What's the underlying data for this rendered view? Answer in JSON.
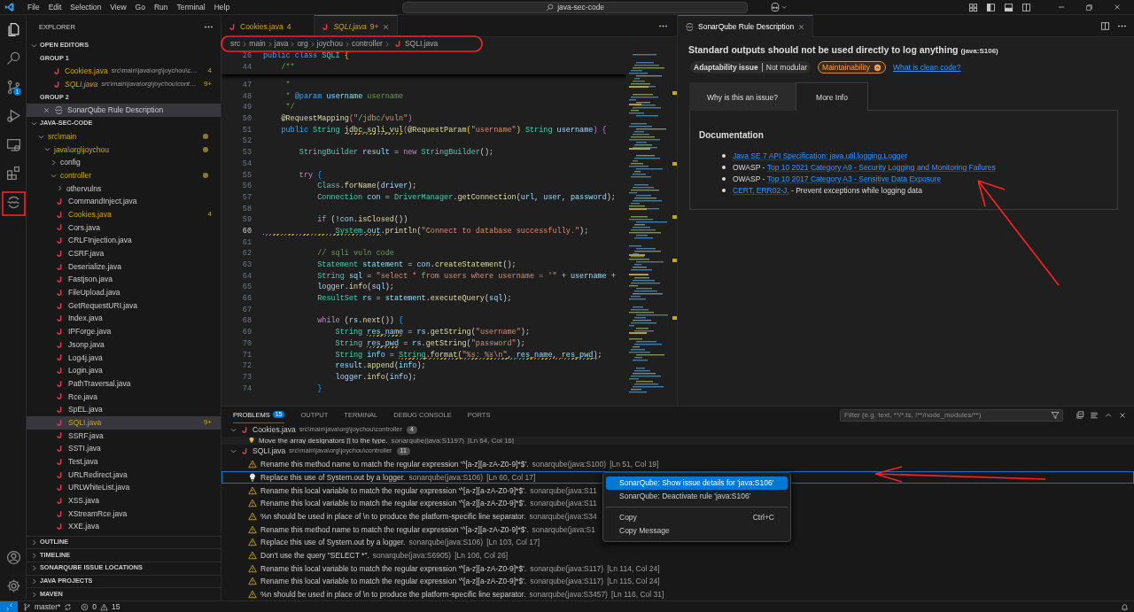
{
  "title_bar": {
    "menu": [
      "File",
      "Edit",
      "Selection",
      "View",
      "Go",
      "Run",
      "Terminal",
      "Help"
    ],
    "command_center": "java-sec-code"
  },
  "activity_bar": {
    "items": [
      {
        "kind": "files"
      },
      {
        "kind": "search"
      },
      {
        "kind": "scm",
        "badge": "1"
      },
      {
        "kind": "debug"
      },
      {
        "kind": "remote"
      },
      {
        "kind": "extensions"
      },
      {
        "kind": "sonar"
      }
    ],
    "bottom": [
      {
        "kind": "account"
      },
      {
        "kind": "gear"
      }
    ]
  },
  "explorer": {
    "title": "EXPLORER",
    "open_editors": {
      "title": "OPEN EDITORS",
      "expanded": true,
      "groups": [
        {
          "title": "GROUP 1",
          "items": [
            {
              "kind": "java",
              "name": "Cookies.java",
              "path": "src\\main\\java\\org\\joychou\\c…",
              "badge": "4",
              "preview": false,
              "selected": false
            },
            {
              "kind": "java",
              "name": "SQLI.java",
              "path": "src\\main\\java\\org\\joychou\\cont…",
              "badge": "9+",
              "preview": true,
              "selected": false
            }
          ]
        },
        {
          "title": "GROUP 2",
          "items": [
            {
              "kind": "sonar",
              "name": "SonarQube Rule Description",
              "preview": false,
              "selected": true
            }
          ]
        }
      ]
    },
    "project": {
      "title": "JAVA-SEC-CODE",
      "expanded": true,
      "tree": [
        {
          "kind": "folder",
          "label": "src\\main",
          "expanded": true,
          "modified": true,
          "children": [
            {
              "kind": "folder",
              "label": "java\\org\\joychou",
              "expanded": true,
              "modified": true,
              "children": [
                {
                  "kind": "folder",
                  "label": "config",
                  "expanded": false,
                  "modified": false
                },
                {
                  "kind": "folder",
                  "label": "controller",
                  "expanded": true,
                  "modified": true,
                  "children": [
                    {
                      "kind": "folder",
                      "label": "othervulns",
                      "expanded": false,
                      "modified": false
                    },
                    {
                      "kind": "file",
                      "label": "CommandInject.java",
                      "warning": false,
                      "selected": false
                    },
                    {
                      "kind": "file",
                      "label": "Cookies.java",
                      "warning": true,
                      "badge": "4",
                      "selected": false
                    },
                    {
                      "kind": "file",
                      "label": "Cors.java",
                      "warning": false,
                      "selected": false
                    },
                    {
                      "kind": "file",
                      "label": "CRLFInjection.java",
                      "warning": false,
                      "selected": false
                    },
                    {
                      "kind": "file",
                      "label": "CSRF.java",
                      "warning": false,
                      "selected": false
                    },
                    {
                      "kind": "file",
                      "label": "Deserialize.java",
                      "warning": false,
                      "selected": false
                    },
                    {
                      "kind": "file",
                      "label": "Fastjson.java",
                      "warning": false,
                      "selected": false
                    },
                    {
                      "kind": "file",
                      "label": "FileUpload.java",
                      "warning": false,
                      "selected": false
                    },
                    {
                      "kind": "file",
                      "label": "GetRequestURI.java",
                      "warning": false,
                      "selected": false
                    },
                    {
                      "kind": "file",
                      "label": "Index.java",
                      "warning": false,
                      "selected": false
                    },
                    {
                      "kind": "file",
                      "label": "IPForge.java",
                      "warning": false,
                      "selected": false
                    },
                    {
                      "kind": "file",
                      "label": "Jsonp.java",
                      "warning": false,
                      "selected": false
                    },
                    {
                      "kind": "file",
                      "label": "Log4j.java",
                      "warning": false,
                      "selected": false
                    },
                    {
                      "kind": "file",
                      "label": "Login.java",
                      "warning": false,
                      "selected": false
                    },
                    {
                      "kind": "file",
                      "label": "PathTraversal.java",
                      "warning": false,
                      "selected": false
                    },
                    {
                      "kind": "file",
                      "label": "Rce.java",
                      "warning": false,
                      "selected": false
                    },
                    {
                      "kind": "file",
                      "label": "SpEL.java",
                      "warning": false,
                      "selected": false
                    },
                    {
                      "kind": "file",
                      "label": "SQLI.java",
                      "warning": true,
                      "badge": "9+",
                      "selected": true
                    },
                    {
                      "kind": "file",
                      "label": "SSRF.java",
                      "warning": false,
                      "selected": false
                    },
                    {
                      "kind": "file",
                      "label": "SSTI.java",
                      "warning": false,
                      "selected": false
                    },
                    {
                      "kind": "file",
                      "label": "Test.java",
                      "warning": false,
                      "selected": false
                    },
                    {
                      "kind": "file",
                      "label": "URLRedirect.java",
                      "warning": false,
                      "selected": false
                    },
                    {
                      "kind": "file",
                      "label": "URLWhiteList.java",
                      "warning": false,
                      "selected": false
                    },
                    {
                      "kind": "file",
                      "label": "XSS.java",
                      "warning": false,
                      "selected": false
                    },
                    {
                      "kind": "file",
                      "label": "XStreamRce.java",
                      "warning": false,
                      "selected": false
                    },
                    {
                      "kind": "file",
                      "label": "XXE.java",
                      "warning": false,
                      "selected": false
                    }
                  ]
                }
              ]
            }
          ]
        }
      ]
    },
    "sections": [
      {
        "title": "OUTLINE",
        "expanded": false
      },
      {
        "title": "TIMELINE",
        "expanded": false
      },
      {
        "title": "SONARQUBE ISSUE LOCATIONS",
        "expanded": false
      },
      {
        "title": "JAVA PROJECTS",
        "expanded": false
      },
      {
        "title": "MAVEN",
        "expanded": false
      }
    ]
  },
  "editor": {
    "tabs": [
      {
        "label": "Cookies.java",
        "badge": "4",
        "selected": false,
        "preview": false
      },
      {
        "label": "SQLI.java",
        "badge": "9+",
        "selected": true,
        "preview": true
      }
    ],
    "breadcrumb": [
      "src",
      "main",
      "java",
      "org",
      "joychou",
      "controller",
      "SQLI.java"
    ],
    "sticky_lines": [
      {
        "number": "26",
        "tokens": [
          {
            "text": "public class ",
            "kind": "keyword"
          },
          {
            "text": "SQLI ",
            "kind": "type"
          },
          {
            "text": "{",
            "kind": "brace"
          }
        ]
      },
      {
        "number": "44",
        "tokens": [
          {
            "text": "    /**",
            "kind": "comment"
          }
        ]
      }
    ],
    "lines": [
      {
        "number": "47",
        "active": false,
        "tokens": [
          {
            "text": "     *",
            "kind": "comment"
          }
        ]
      },
      {
        "number": "48",
        "active": false,
        "tokens": [
          {
            "text": "     * ",
            "kind": "comment"
          },
          {
            "text": "@param",
            "kind": "keyword"
          },
          {
            "text": " username",
            "kind": "variable"
          },
          {
            "text": " username",
            "kind": "comment"
          }
        ]
      },
      {
        "number": "49",
        "active": false,
        "tokens": [
          {
            "text": "     */",
            "kind": "comment"
          }
        ]
      },
      {
        "number": "50",
        "active": false,
        "tokens": [
          {
            "text": "    @RequestMapping",
            "kind": "annotation"
          },
          {
            "text": "(",
            "kind": "paren"
          },
          {
            "text": "\"/jdbc/vuln\"",
            "kind": "string"
          },
          {
            "text": ")",
            "kind": "paren"
          }
        ]
      },
      {
        "number": "51",
        "active": false,
        "tokens": [
          {
            "text": "    public ",
            "kind": "keyword"
          },
          {
            "text": "String ",
            "kind": "type"
          },
          {
            "text": "jdbc_sqli_vul",
            "kind": "function",
            "warning": true
          },
          {
            "text": "(",
            "kind": "paren"
          },
          {
            "text": "@RequestParam",
            "kind": "annotation"
          },
          {
            "text": "(",
            "kind": "brace"
          },
          {
            "text": "\"username\"",
            "kind": "string"
          },
          {
            "text": ") ",
            "kind": "brace"
          },
          {
            "text": "String ",
            "kind": "type"
          },
          {
            "text": "username",
            "kind": "variable"
          },
          {
            "text": ") {",
            "kind": "paren"
          }
        ]
      },
      {
        "number": "52",
        "active": false
      },
      {
        "number": "53",
        "active": false,
        "tokens": [
          {
            "text": "        StringBuilder ",
            "kind": "type"
          },
          {
            "text": "result",
            "kind": "variable"
          },
          {
            "text": " = ",
            "kind": "plain"
          },
          {
            "text": "new ",
            "kind": "control"
          },
          {
            "text": "StringBuilder",
            "kind": "type"
          },
          {
            "text": "();",
            "kind": "plain"
          }
        ]
      },
      {
        "number": "54",
        "active": false
      },
      {
        "number": "55",
        "active": false,
        "tokens": [
          {
            "text": "        try ",
            "kind": "control"
          },
          {
            "text": "{",
            "kind": "bracket"
          }
        ]
      },
      {
        "number": "56",
        "active": false,
        "tokens": [
          {
            "text": "            Class",
            "kind": "type"
          },
          {
            "text": ".",
            "kind": "plain"
          },
          {
            "text": "forName",
            "kind": "function"
          },
          {
            "text": "(",
            "kind": "plain"
          },
          {
            "text": "driver",
            "kind": "variable"
          },
          {
            "text": ");",
            "kind": "plain"
          }
        ]
      },
      {
        "number": "57",
        "active": false,
        "tokens": [
          {
            "text": "            Connection ",
            "kind": "type"
          },
          {
            "text": "con",
            "kind": "variable"
          },
          {
            "text": " = ",
            "kind": "plain"
          },
          {
            "text": "DriverManager",
            "kind": "type"
          },
          {
            "text": ".",
            "kind": "plain"
          },
          {
            "text": "getConnection",
            "kind": "function"
          },
          {
            "text": "(",
            "kind": "plain"
          },
          {
            "text": "url",
            "kind": "variable"
          },
          {
            "text": ", ",
            "kind": "plain"
          },
          {
            "text": "user",
            "kind": "variable"
          },
          {
            "text": ", ",
            "kind": "plain"
          },
          {
            "text": "password",
            "kind": "variable"
          },
          {
            "text": ");",
            "kind": "plain"
          }
        ]
      },
      {
        "number": "58",
        "active": false
      },
      {
        "number": "59",
        "active": false,
        "tokens": [
          {
            "text": "            if ",
            "kind": "control"
          },
          {
            "text": "(!",
            "kind": "plain"
          },
          {
            "text": "con",
            "kind": "variable"
          },
          {
            "text": ".",
            "kind": "plain"
          },
          {
            "text": "isClosed",
            "kind": "function"
          },
          {
            "text": "())",
            "kind": "plain"
          }
        ]
      },
      {
        "number": "60",
        "active": true,
        "tokens": [
          {
            "text": "                System",
            "kind": "type",
            "warning": true
          },
          {
            "text": ".",
            "kind": "plain",
            "warning": true
          },
          {
            "text": "out",
            "kind": "variable",
            "warning": true
          },
          {
            "text": ".",
            "kind": "plain"
          },
          {
            "text": "println",
            "kind": "function"
          },
          {
            "text": "(",
            "kind": "plain"
          },
          {
            "text": "\"Connect to database successfully.\"",
            "kind": "string"
          },
          {
            "text": ");",
            "kind": "plain"
          }
        ]
      },
      {
        "number": "61",
        "active": false
      },
      {
        "number": "62",
        "active": false,
        "tokens": [
          {
            "text": "            // sqli vuln code",
            "kind": "comment"
          }
        ]
      },
      {
        "number": "63",
        "active": false,
        "tokens": [
          {
            "text": "            Statement ",
            "kind": "type"
          },
          {
            "text": "statement",
            "kind": "variable"
          },
          {
            "text": " = ",
            "kind": "plain"
          },
          {
            "text": "con",
            "kind": "variable"
          },
          {
            "text": ".",
            "kind": "plain"
          },
          {
            "text": "createStatement",
            "kind": "function"
          },
          {
            "text": "();",
            "kind": "plain"
          }
        ]
      },
      {
        "number": "64",
        "active": false,
        "tokens": [
          {
            "text": "            String ",
            "kind": "type"
          },
          {
            "text": "sql",
            "kind": "variable"
          },
          {
            "text": " = ",
            "kind": "plain"
          },
          {
            "text": "\"select * from users where username = '\"",
            "kind": "string"
          },
          {
            "text": " + ",
            "kind": "plain"
          },
          {
            "text": "username",
            "kind": "variable"
          },
          {
            "text": " +",
            "kind": "plain"
          }
        ]
      },
      {
        "number": "65",
        "active": false,
        "tokens": [
          {
            "text": "            logger",
            "kind": "variable"
          },
          {
            "text": ".",
            "kind": "plain"
          },
          {
            "text": "info",
            "kind": "function"
          },
          {
            "text": "(",
            "kind": "plain"
          },
          {
            "text": "sql",
            "kind": "variable"
          },
          {
            "text": ");",
            "kind": "plain"
          }
        ]
      },
      {
        "number": "66",
        "active": false,
        "tokens": [
          {
            "text": "            ResultSet ",
            "kind": "type"
          },
          {
            "text": "rs",
            "kind": "variable"
          },
          {
            "text": " = ",
            "kind": "plain"
          },
          {
            "text": "statement",
            "kind": "variable"
          },
          {
            "text": ".",
            "kind": "plain"
          },
          {
            "text": "executeQuery",
            "kind": "function"
          },
          {
            "text": "(",
            "kind": "plain"
          },
          {
            "text": "sql",
            "kind": "variable"
          },
          {
            "text": ");",
            "kind": "plain"
          }
        ]
      },
      {
        "number": "67",
        "active": false
      },
      {
        "number": "68",
        "active": false,
        "tokens": [
          {
            "text": "            while ",
            "kind": "control"
          },
          {
            "text": "(",
            "kind": "plain"
          },
          {
            "text": "rs",
            "kind": "variable"
          },
          {
            "text": ".",
            "kind": "plain"
          },
          {
            "text": "next",
            "kind": "function"
          },
          {
            "text": "()) ",
            "kind": "plain"
          },
          {
            "text": "{",
            "kind": "bracket"
          }
        ]
      },
      {
        "number": "69",
        "active": false,
        "tokens": [
          {
            "text": "                String ",
            "kind": "type"
          },
          {
            "text": "res_name",
            "kind": "variable",
            "warning": true
          },
          {
            "text": " = ",
            "kind": "plain"
          },
          {
            "text": "rs",
            "kind": "variable"
          },
          {
            "text": ".",
            "kind": "plain"
          },
          {
            "text": "getString",
            "kind": "function"
          },
          {
            "text": "(",
            "kind": "plain"
          },
          {
            "text": "\"username\"",
            "kind": "string"
          },
          {
            "text": ");",
            "kind": "plain"
          }
        ]
      },
      {
        "number": "70",
        "active": false,
        "tokens": [
          {
            "text": "                String ",
            "kind": "type"
          },
          {
            "text": "res_pwd",
            "kind": "variable",
            "warning": true
          },
          {
            "text": " = ",
            "kind": "plain"
          },
          {
            "text": "rs",
            "kind": "variable"
          },
          {
            "text": ".",
            "kind": "plain"
          },
          {
            "text": "getString",
            "kind": "function"
          },
          {
            "text": "(",
            "kind": "plain"
          },
          {
            "text": "\"password\"",
            "kind": "string"
          },
          {
            "text": ");",
            "kind": "plain"
          }
        ]
      },
      {
        "number": "71",
        "active": false,
        "tokens": [
          {
            "text": "                String ",
            "kind": "type"
          },
          {
            "text": "info",
            "kind": "variable"
          },
          {
            "text": " = ",
            "kind": "plain"
          },
          {
            "text": "String",
            "kind": "type",
            "warning": true
          },
          {
            "text": ".",
            "kind": "plain",
            "warning": true
          },
          {
            "text": "format",
            "kind": "function",
            "warning": true
          },
          {
            "text": "(",
            "kind": "plain",
            "warning": true
          },
          {
            "text": "\"%s: %s\\n\"",
            "kind": "string",
            "warning": true
          },
          {
            "text": ", ",
            "kind": "plain",
            "warning": true
          },
          {
            "text": "res_name",
            "kind": "variable",
            "warning": true
          },
          {
            "text": ", ",
            "kind": "plain",
            "warning": true
          },
          {
            "text": "res_pwd",
            "kind": "variable",
            "warning": true
          },
          {
            "text": ")",
            "kind": "plain",
            "warning": true
          },
          {
            "text": ";",
            "kind": "plain"
          }
        ]
      },
      {
        "number": "72",
        "active": false,
        "tokens": [
          {
            "text": "                result",
            "kind": "variable"
          },
          {
            "text": ".",
            "kind": "plain"
          },
          {
            "text": "append",
            "kind": "function"
          },
          {
            "text": "(",
            "kind": "plain"
          },
          {
            "text": "info",
            "kind": "variable"
          },
          {
            "text": ");",
            "kind": "plain"
          }
        ]
      },
      {
        "number": "73",
        "active": false,
        "tokens": [
          {
            "text": "                logger",
            "kind": "variable"
          },
          {
            "text": ".",
            "kind": "plain"
          },
          {
            "text": "info",
            "kind": "function"
          },
          {
            "text": "(",
            "kind": "plain"
          },
          {
            "text": "info",
            "kind": "variable"
          },
          {
            "text": ");",
            "kind": "plain"
          }
        ]
      },
      {
        "number": "74",
        "active": false,
        "tokens": [
          {
            "text": "            }",
            "kind": "bracket"
          }
        ]
      }
    ]
  },
  "rule_panel": {
    "tab": "SonarQube Rule Description",
    "title": "Standard outputs should not be used directly to log anything",
    "rule_key": "(java:S106)",
    "attribute": "Adaptability issue",
    "attribute_detail": "Not modular",
    "quality": "Maintainability",
    "clean_code_link": "What is clean code?",
    "tabs": [
      {
        "label": "Why is this an issue?",
        "selected": false
      },
      {
        "label": "More Info",
        "selected": true
      }
    ],
    "heading": "Documentation",
    "links": [
      {
        "link": "Java SE 7 API Specification: java.util.logging.Logger"
      },
      {
        "prefix": "OWASP - ",
        "link": "Top 10 2021 Category A9 - Security Logging and Monitoring Failures"
      },
      {
        "prefix": "OWASP - ",
        "link": "Top 10 2017 Category A3 - Sensitive Data Exposure"
      },
      {
        "link": "CERT, ERR02-J.",
        "suffix": " - Prevent exceptions while logging data"
      }
    ]
  },
  "panel": {
    "tabs": [
      {
        "label": "PROBLEMS",
        "badge": "15",
        "selected": true
      },
      {
        "label": "OUTPUT",
        "selected": false
      },
      {
        "label": "TERMINAL",
        "selected": false
      },
      {
        "label": "DEBUG CONSOLE",
        "selected": false
      },
      {
        "label": "PORTS",
        "selected": false
      }
    ],
    "filter_placeholder": "Filter (e.g. text, **/*.ts, !**/node_modules/**)",
    "groups": [
      {
        "file": "Cookies.java",
        "path": "src\\main\\java\\org\\joychou\\controller",
        "count": "4",
        "expanded": true,
        "problems": [
          {
            "kind": "bulb",
            "message": "Move the array designators [] to the type.",
            "source": "sonarqube(java:S1197)",
            "location": "[Ln 64, Col 16]",
            "partial": true,
            "focused": false
          }
        ]
      },
      {
        "file": "SQLI.java",
        "path": "src\\main\\java\\org\\joychou\\controller",
        "count": "11",
        "expanded": true,
        "problems": [
          {
            "kind": "warning",
            "message": "Rename this method name to match the regular expression '^[a-z][a-zA-Z0-9]*$'.",
            "source": "sonarqube(java:S100)",
            "location": "[Ln 51, Col 19]",
            "focused": false
          },
          {
            "kind": "bulb",
            "message": "Replace this use of System.out by a logger.",
            "source": "sonarqube(java:S106)",
            "location": "[Ln 60, Col 17]",
            "focused": true
          },
          {
            "kind": "warning",
            "message": "Rename this local variable to match the regular expression '^[a-z][a-zA-Z0-9]*$'.",
            "source": "sonarqube(java:S11",
            "focused": false
          },
          {
            "kind": "warning",
            "message": "Rename this local variable to match the regular expression '^[a-z][a-zA-Z0-9]*$'.",
            "source": "sonarqube(java:S11",
            "focused": false
          },
          {
            "kind": "warning",
            "message": "%n should be used in place of \\n to produce the platform-specific line separator.",
            "source": "sonarqube(java:S34",
            "focused": false
          },
          {
            "kind": "warning",
            "message": "Rename this method name to match the regular expression '^[a-z][a-zA-Z0-9]*$'.",
            "source": "sonarqube(java:S1",
            "focused": false
          },
          {
            "kind": "warning",
            "message": "Replace this use of System.out by a logger.",
            "source": "sonarqube(java:S106)",
            "location": "[Ln 103, Col 17]",
            "focused": false
          },
          {
            "kind": "warning",
            "message": "Don't use the query \"SELECT *\".",
            "source": "sonarqube(java:S6905)",
            "location": "[Ln 106, Col 26]",
            "focused": false
          },
          {
            "kind": "warning",
            "message": "Rename this local variable to match the regular expression '^[a-z][a-zA-Z0-9]*$'.",
            "source": "sonarqube(java:S117)",
            "location": "[Ln 114, Col 24]",
            "focused": false
          },
          {
            "kind": "warning",
            "message": "Rename this local variable to match the regular expression '^[a-z][a-zA-Z0-9]*$'.",
            "source": "sonarqube(java:S117)",
            "location": "[Ln 115, Col 24]",
            "focused": false
          },
          {
            "kind": "warning",
            "message": "%n should be used in place of \\n to produce the platform-specific line separator.",
            "source": "sonarqube(java:S3457)",
            "location": "[Ln 116, Col 31]",
            "focused": false
          }
        ]
      }
    ]
  },
  "context_menu": {
    "items": [
      {
        "label": "SonarQube: Show issue details for 'java:S106'",
        "selected": true
      },
      {
        "label": "SonarQube: Deactivate rule 'java:S106'",
        "selected": false
      },
      {
        "label": "Copy",
        "shortcut": "Ctrl+C",
        "separator_before": true,
        "selected": false
      },
      {
        "label": "Copy Message",
        "selected": false
      }
    ]
  },
  "status_bar": {
    "branch": "master*",
    "errors": "0",
    "warnings": "15"
  }
}
